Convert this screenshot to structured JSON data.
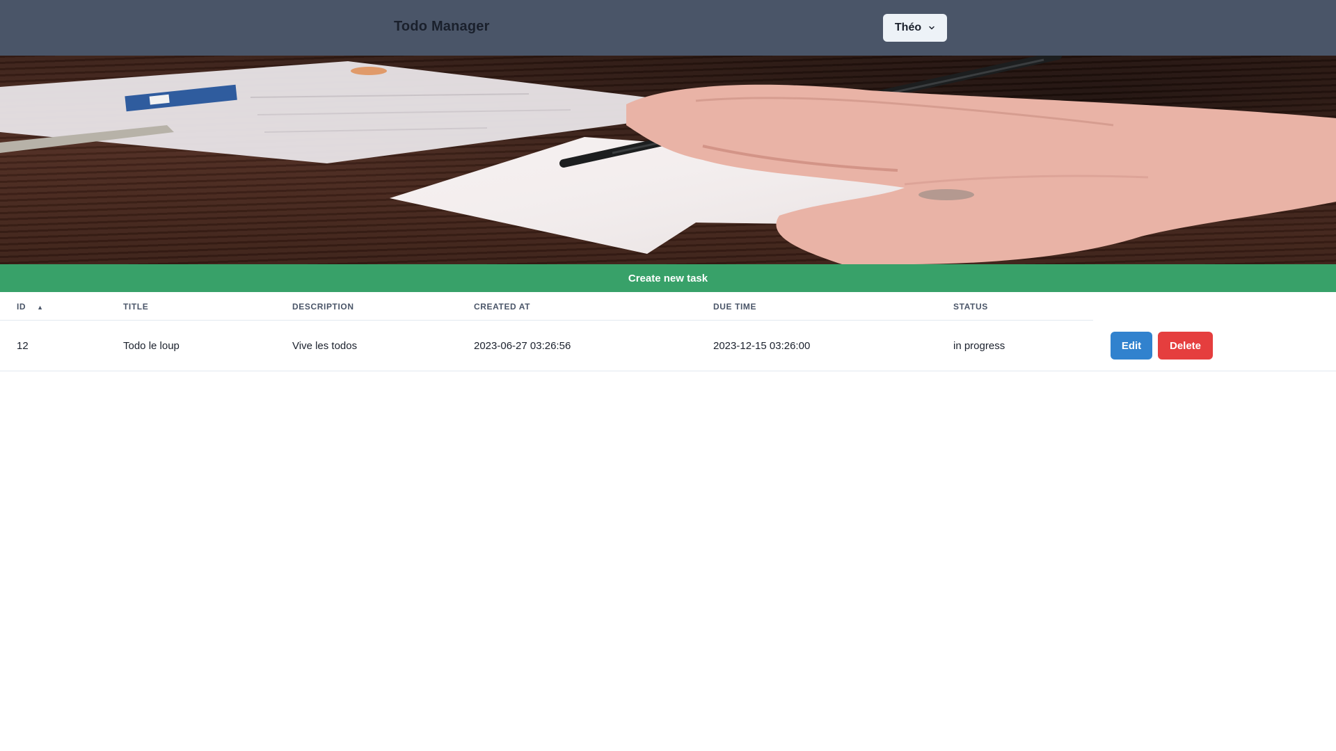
{
  "header": {
    "title": "Todo Manager",
    "user_menu": {
      "label": "Théo",
      "icon": "chevron-down-icon"
    }
  },
  "hero": {
    "image": "desk-writing-photo"
  },
  "actions": {
    "create_label": "Create new task"
  },
  "table": {
    "columns": [
      {
        "key": "id",
        "label": "ID",
        "sorted": "ascending"
      },
      {
        "key": "title",
        "label": "TITLE"
      },
      {
        "key": "description",
        "label": "DESCRIPTION"
      },
      {
        "key": "created_at",
        "label": "CREATED AT"
      },
      {
        "key": "due_time",
        "label": "DUE TIME"
      },
      {
        "key": "status",
        "label": "STATUS"
      }
    ],
    "rows": [
      {
        "id": "12",
        "title": "Todo le loup",
        "description": "Vive les todos",
        "created_at": "2023-06-27 03:26:56",
        "due_time": "2023-12-15 03:26:00",
        "status": "in progress",
        "edit_label": "Edit",
        "delete_label": "Delete"
      }
    ]
  },
  "colors": {
    "header_bg": "#4a5568",
    "create_bg": "#38a169",
    "edit_bg": "#3182ce",
    "delete_bg": "#e53e3e"
  }
}
